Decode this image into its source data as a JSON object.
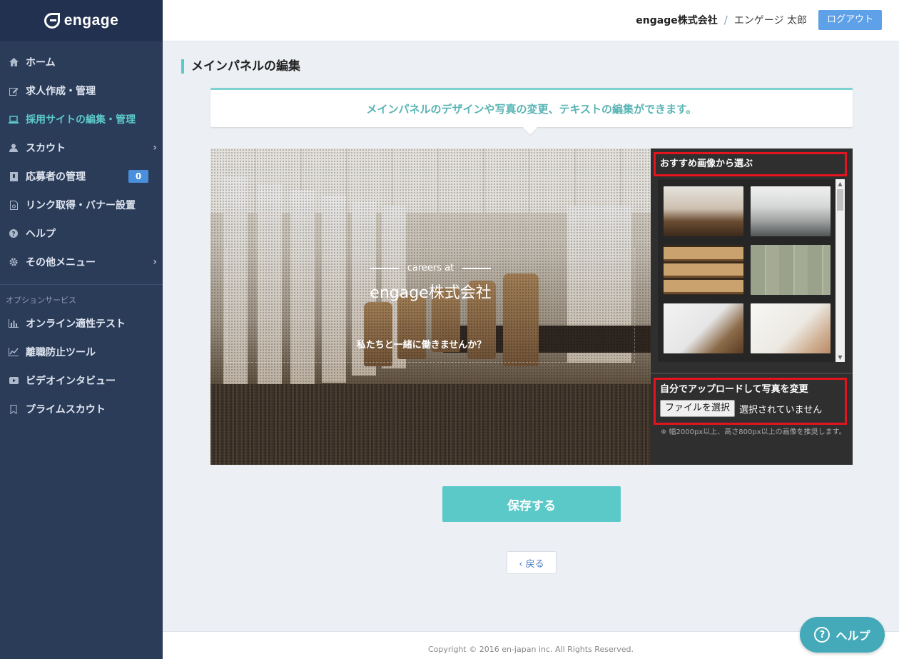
{
  "app": {
    "logo_text": "engage"
  },
  "header": {
    "company": "engage株式会社",
    "separator": "/",
    "user": "エンゲージ 太郎",
    "logout_label": "ログアウト"
  },
  "sidebar": {
    "items": [
      {
        "label": "ホーム",
        "icon": "home-icon"
      },
      {
        "label": "求人作成・管理",
        "icon": "edit-icon"
      },
      {
        "label": "採用サイトの編集・管理",
        "icon": "laptop-icon",
        "active": true
      },
      {
        "label": "スカウト",
        "icon": "user-icon"
      },
      {
        "label": "応募者の管理",
        "icon": "applicant-icon",
        "badge": "0"
      },
      {
        "label": "リンク取得・バナー設置",
        "icon": "link-doc-icon"
      },
      {
        "label": "ヘルプ",
        "icon": "question-icon"
      },
      {
        "label": "その他メニュー",
        "icon": "gear-icon"
      }
    ],
    "section_label": "オプションサービス",
    "option_items": [
      {
        "label": "オンライン適性テスト",
        "icon": "bar-chart-icon"
      },
      {
        "label": "離職防止ツール",
        "icon": "line-chart-icon"
      },
      {
        "label": "ビデオインタビュー",
        "icon": "video-icon"
      },
      {
        "label": "プライムスカウト",
        "icon": "bookmark-icon"
      }
    ]
  },
  "main": {
    "page_title": "メインパネルの編集",
    "info_text": "メインパネルのデザインや写真の変更、テキストの編集ができます。",
    "hero": {
      "careers_at": "careers at",
      "company": "engage株式会社",
      "message": "私たちと一緒に働きませんか？"
    },
    "panel": {
      "recommended_label": "おすすめ画像から選ぶ",
      "upload_label": "自分でアップロードして写真を変更",
      "file_button": "ファイルを選択",
      "file_status": "選択されていません",
      "note": "※ 幅2000px以上、高さ800px以上の画像を推奨します。"
    },
    "save_label": "保存する",
    "back_label": "‹ 戻る"
  },
  "footer": {
    "copyright": "Copyright © 2016 en-japan inc. All Rights Reserved."
  },
  "help_float": {
    "label": "ヘルプ",
    "icon": "question-icon"
  },
  "colors": {
    "accent": "#5cc9c9",
    "sidebar": "#2b3c59",
    "highlight": "#e1141f",
    "logout": "#5ea1e8"
  }
}
